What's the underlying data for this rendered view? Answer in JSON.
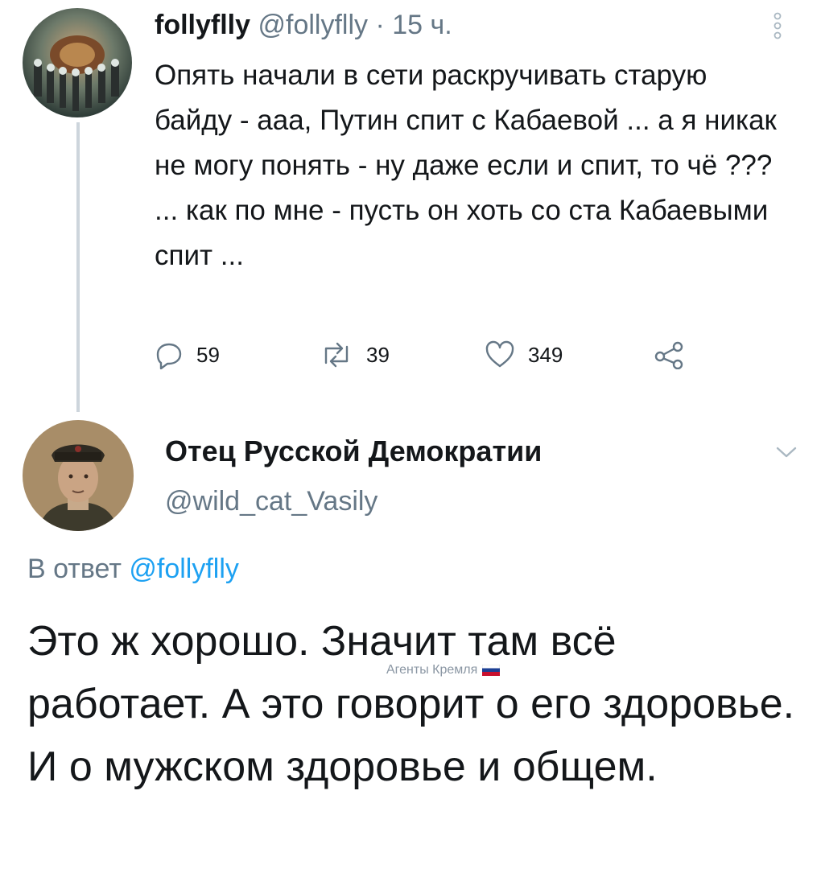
{
  "parent_tweet": {
    "display_name": "follyflly",
    "handle": "@follyflly",
    "time": "· 15 ч.",
    "text": "Опять начали в сети раскручивать старую байду - ааа, Путин спит с Кабаевой  ... а я никак не могу понять - ну даже если и спит, то чё ??? ... как по мне - пусть он хоть со ста Кабаевыми спит ...",
    "menu_icon": "vertical-dots-icon",
    "avatar": "hallway-avatar",
    "actions": {
      "replies": "59",
      "retweets": "39",
      "likes": "349"
    },
    "action_icons": [
      "reply-icon",
      "retweet-icon",
      "like-icon",
      "share-icon"
    ]
  },
  "reply_tweet": {
    "display_name": "Отец Русской Демократии",
    "handle": "@wild_cat_Vasily",
    "avatar": "soldier-portrait-avatar",
    "menu_icon": "chevron-down-icon",
    "reply_prefix": "В ответ",
    "reply_to_handle": "@follyflly",
    "text": "Это ж хорошо. Значит там всё работает. А это говорит о его здоровье. И о мужском здоровье и общем."
  },
  "watermark": {
    "text": "Агенты Кремля",
    "icon": "russian-flag-icon"
  },
  "colors": {
    "text": "#14171a",
    "secondary": "#657786",
    "link": "#1da1f2",
    "thread_line": "#cdd5dc"
  }
}
